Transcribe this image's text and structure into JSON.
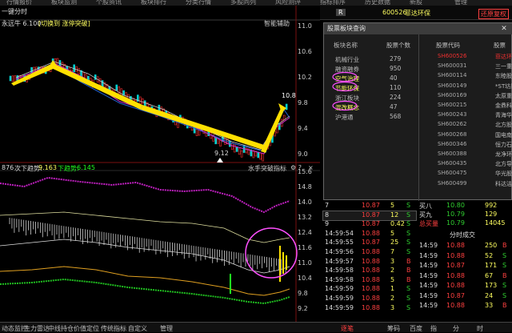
{
  "menu": [
    "行情报价",
    "板块监测",
    "个股资讯",
    "板块排行",
    "分类行情",
    "多股同列",
    "风险测评",
    "指标排序",
    "历史数据",
    "新股",
    "管理"
  ],
  "stock_header": {
    "label": "一键分时",
    "code": "600526",
    "name": "菲达环保",
    "button": "还原复权"
  },
  "chart_top": {
    "title": "永远牛 6.100",
    "mode": "[切换到 涨停突破]",
    "right": "智能辅助",
    "low_price": "9.12",
    "high_price": "10.8",
    "axis": [
      "11.0",
      "10.6",
      "10.2",
      "9.8",
      "9.4",
      "9.0"
    ]
  },
  "indicator": {
    "line1": "876",
    "line1_label": "次下趋势:",
    "line1_val": "9.163",
    "line2_label": "下趋势:",
    "line2_val": "6.145",
    "right": "水手突破指标"
  },
  "indicator_axis": [
    "15.6",
    "14.8",
    "14.0",
    "13.2",
    "12.4",
    "11.6",
    "11.0",
    "10.4",
    "9.8",
    "9.2"
  ],
  "popup": {
    "title": "股票板块查询",
    "col_block": "板块名称",
    "col_count": "股票个数",
    "col_code": "股票代码",
    "col_stock": "股票",
    "blocks": [
      [
        "机械行业",
        "279"
      ],
      [
        "融资融券",
        "950"
      ],
      [
        "空气治理",
        "40"
      ],
      [
        "节能环保",
        "110"
      ],
      [
        "浙江板块",
        "224"
      ],
      [
        "混改概念",
        "47"
      ],
      [
        "沪港通",
        "568"
      ]
    ],
    "stocks": [
      [
        "SH600526",
        "菲达环保"
      ],
      [
        "SH600031",
        "三一重工"
      ],
      [
        "SH600114",
        "东睦股份"
      ],
      [
        "SH600149",
        "*ST坊展"
      ],
      [
        "SH600169",
        "太原重工"
      ],
      [
        "SH600215",
        "金鼎科技"
      ],
      [
        "SH600243",
        "青海华鼎"
      ],
      [
        "SH600262",
        "北方股份"
      ],
      [
        "SH600268",
        "国电南自"
      ],
      [
        "SH600346",
        "恒力石化"
      ],
      [
        "SH600388",
        "龙净环保"
      ],
      [
        "SH600435",
        "北方导航"
      ],
      [
        "SH600475",
        "华光股份"
      ],
      [
        "SH600499",
        "科达洁能"
      ]
    ]
  },
  "orders": [
    [
      "7",
      "10.87",
      "5",
      "S"
    ],
    [
      "8",
      "10.87",
      "12",
      "S"
    ],
    [
      "9",
      "10.87",
      "0.42",
      "S"
    ],
    [
      "14:59:54",
      "10.88",
      "5",
      "S"
    ],
    [
      "14:59:55",
      "10.87",
      "25",
      "S"
    ],
    [
      "14:59:56",
      "10.88",
      "7",
      "S"
    ],
    [
      "14:59:57",
      "10.88",
      "3",
      "B"
    ],
    [
      "14:59:58",
      "10.88",
      "2",
      "B"
    ],
    [
      "14:59:58",
      "10.88",
      "5",
      "B"
    ],
    [
      "14:59:59",
      "10.88",
      "1",
      "S"
    ],
    [
      "14:59:59",
      "10.88",
      "2",
      "S"
    ],
    [
      "14:59:59",
      "10.88",
      "3",
      "S"
    ]
  ],
  "quote": {
    "rows": [
      [
        "买八",
        "10.80",
        "992"
      ],
      [
        "买九",
        "10.79",
        "129"
      ],
      [
        "总买量",
        "10.79",
        "14045"
      ]
    ],
    "title": "分时成交",
    "trades": [
      [
        "14:59",
        "10.88",
        "250",
        "B"
      ],
      [
        "14:59",
        "10.88",
        "52",
        "S"
      ],
      [
        "14:59",
        "10.87",
        "171",
        "S"
      ],
      [
        "14:59",
        "10.88",
        "67",
        "B"
      ],
      [
        "14:59",
        "10.88",
        "173",
        "S"
      ],
      [
        "14:59",
        "10.87",
        "24",
        "S"
      ],
      [
        "14:59",
        "10.88",
        "33",
        "B"
      ]
    ]
  },
  "bottom": [
    "动态监控",
    "主力雷达",
    "中线持仓",
    "价值定位",
    "传统指标",
    "自定义",
    "管理",
    "逐笔",
    "筹码",
    "百度",
    "指",
    "分",
    "时"
  ]
}
